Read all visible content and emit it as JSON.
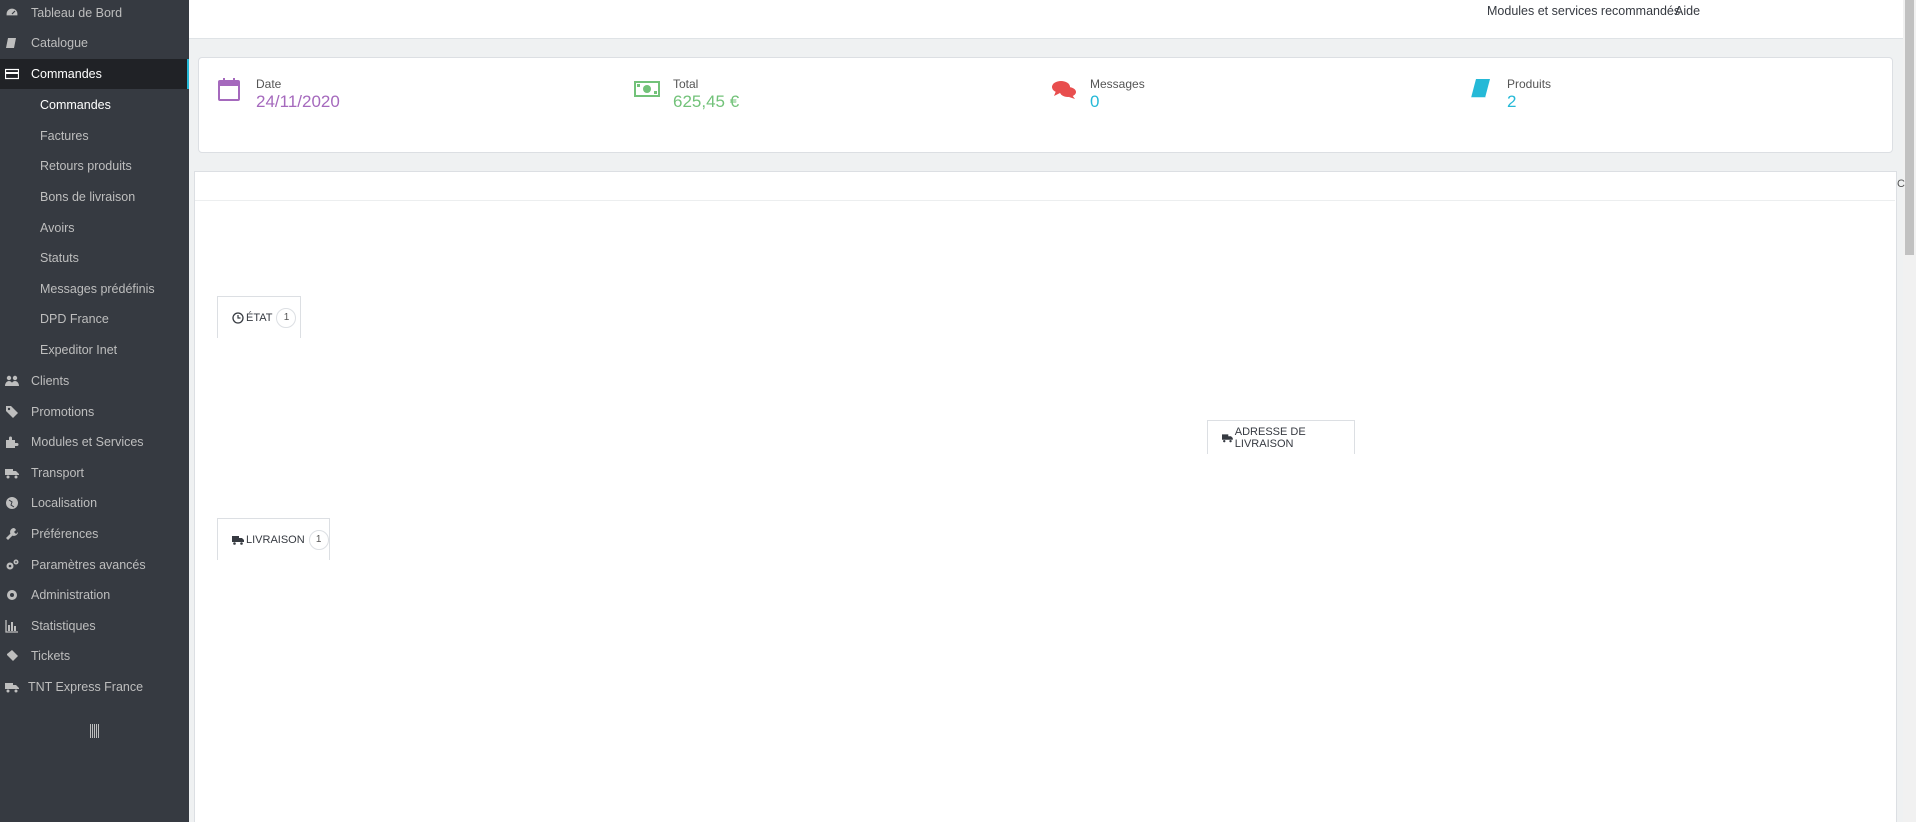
{
  "sidebar": {
    "items": [
      {
        "label": "Tableau de Bord",
        "icon": "dashboard-icon"
      },
      {
        "label": "Catalogue",
        "icon": "book-icon"
      },
      {
        "label": "Commandes",
        "icon": "credit-card-icon",
        "active": true
      },
      {
        "label": "Clients",
        "icon": "users-icon"
      },
      {
        "label": "Promotions",
        "icon": "tags-icon"
      },
      {
        "label": "Modules et Services",
        "icon": "puzzle-icon"
      },
      {
        "label": "Transport",
        "icon": "truck-icon"
      },
      {
        "label": "Localisation",
        "icon": "globe-icon"
      },
      {
        "label": "Préférences",
        "icon": "wrench-icon"
      },
      {
        "label": "Paramètres avancés",
        "icon": "cogs-icon"
      },
      {
        "label": "Administration",
        "icon": "gear-icon"
      },
      {
        "label": "Statistiques",
        "icon": "bar-chart-icon"
      },
      {
        "label": "Tickets",
        "icon": "ticket-icon"
      },
      {
        "label": "TNT Express France",
        "icon": "truck-icon"
      }
    ],
    "subitems": [
      {
        "label": "Commandes",
        "active": true
      },
      {
        "label": "Factures"
      },
      {
        "label": "Retours produits"
      },
      {
        "label": "Bons de livraison"
      },
      {
        "label": "Avoirs"
      },
      {
        "label": "Statuts"
      },
      {
        "label": "Messages prédéfinis"
      },
      {
        "label": "DPD France"
      },
      {
        "label": "Expeditor Inet"
      }
    ]
  },
  "header": {
    "modules_link": "Modules et services recommandés",
    "help_link": "Aide"
  },
  "kpis": [
    {
      "title": "Date",
      "value": "24/11/2020",
      "icon": "calendar-icon",
      "color": "#a569bd"
    },
    {
      "title": "Total",
      "value": "625,45 €",
      "icon": "money-icon",
      "color": "#72c279"
    },
    {
      "title": "Messages",
      "value": "0",
      "icon": "comments-icon",
      "color": "#25b9d7"
    },
    {
      "title": "Produits",
      "value": "2",
      "icon": "book-icon",
      "color": "#25b9d7"
    }
  ],
  "tabs": {
    "etat": {
      "label": "ÉTAT",
      "count": "1"
    },
    "adresse": {
      "label": "ADRESSE DE LIVRAISON"
    },
    "livraison": {
      "label": "LIVRAISON",
      "count": "1"
    }
  },
  "misc": {
    "edge_glyph": "C"
  }
}
